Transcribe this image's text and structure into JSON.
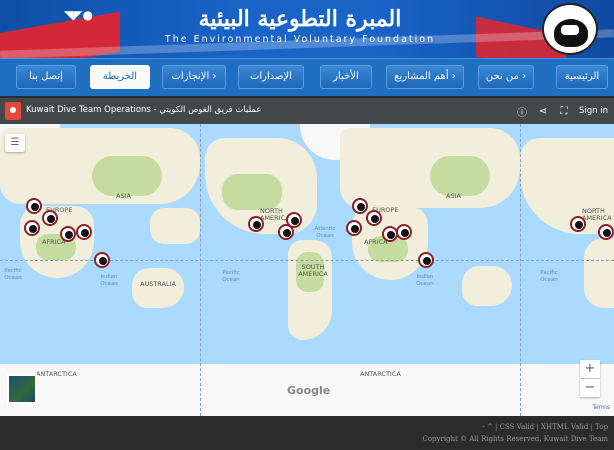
{
  "header": {
    "title_ar": "المبرة التطوعية البيئية",
    "title_en": "The Environmental Voluntary Foundation"
  },
  "nav": {
    "items": [
      {
        "label": "الرئيسية"
      },
      {
        "label": "من نحن ›"
      },
      {
        "label": "أهم المشاريع ›"
      },
      {
        "label": "الأخبار"
      },
      {
        "label": "الإصدارات"
      },
      {
        "label": "الإنجازات ›"
      },
      {
        "label": "الخريطة",
        "active": true
      },
      {
        "label": "إتصل بنا"
      }
    ]
  },
  "map": {
    "title": "Kuwait Dive Team Operations - عمليات فريق الغوص الكويتي",
    "sign_in": "Sign in",
    "icons": [
      "map-pin-icon",
      "info-icon",
      "share-icon",
      "fullscreen-icon"
    ],
    "continent_labels": [
      "EUROPE",
      "ASIA",
      "AFRICA",
      "AUSTRALIA",
      "ANTARCTICA",
      "NORTH AMERICA",
      "SOUTH AMERICA",
      "EUROPE",
      "AFRICA",
      "ASIA",
      "ANTARCTICA",
      "NORTH AMERICA"
    ],
    "ocean_labels": [
      "Indian Ocean",
      "Pacific Ocean",
      "Atlantic Ocean",
      "Pacific Ocean",
      "Indian Ocean",
      "Pacific Ocean"
    ],
    "zoom_in": "+",
    "zoom_out": "−",
    "brand": "Google",
    "terms": "Terms"
  },
  "footer": {
    "links": "- ^ | CSS Valid | XHTML Valid | Top",
    "copyright": "Copyright © All Rights Reserved, Kuwait Dive Team"
  },
  "colors": {
    "nav_bg": "#1f6fc0",
    "banner_red": "#e8242b",
    "water": "#aadaff",
    "land": "#f1eedb",
    "footer": "#2b2b2b"
  }
}
